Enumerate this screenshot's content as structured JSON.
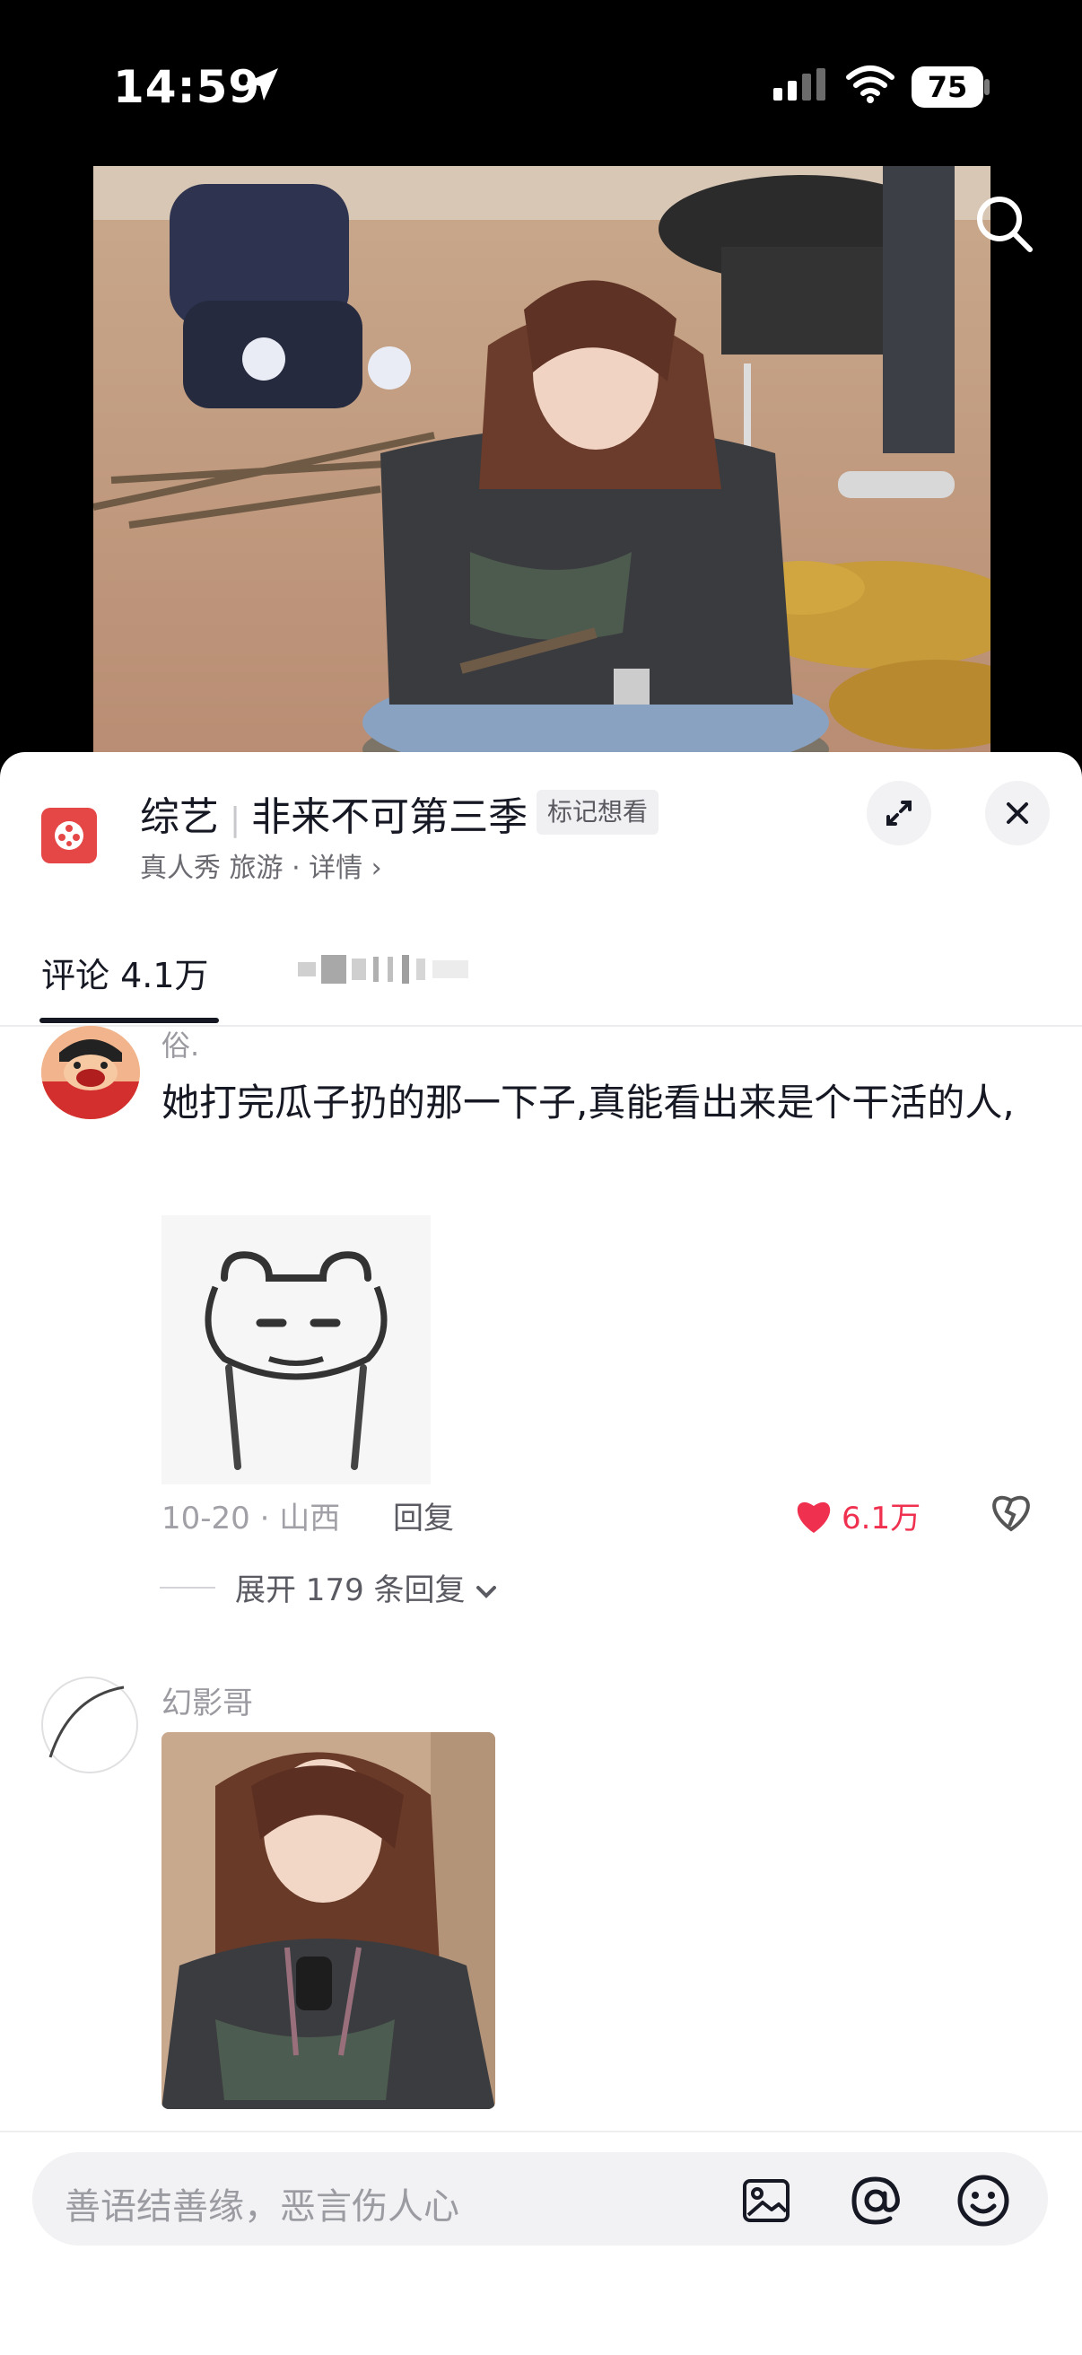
{
  "status_bar": {
    "time": "14:59",
    "battery": "75"
  },
  "show": {
    "category": "综艺",
    "title": "非来不可第三季",
    "mark_button": "标记想看",
    "subtitle": "真人秀 旅游 · 详情 ›"
  },
  "tabs": {
    "comments": "评论 4.1万"
  },
  "comments": [
    {
      "user": "俗.",
      "text": "她打完瓜子扔的那一下子,真能看出来是个干活的人,",
      "meta": "10-20 · 山西",
      "reply": "回复",
      "likes": "6.1万",
      "expand": "展开 179 条回复"
    },
    {
      "user": "幻影哥"
    }
  ],
  "input": {
    "placeholder": "善语结善缘，恶言伤人心"
  },
  "colors": {
    "like": "#f0304f",
    "brand_icon": "#e54646"
  }
}
